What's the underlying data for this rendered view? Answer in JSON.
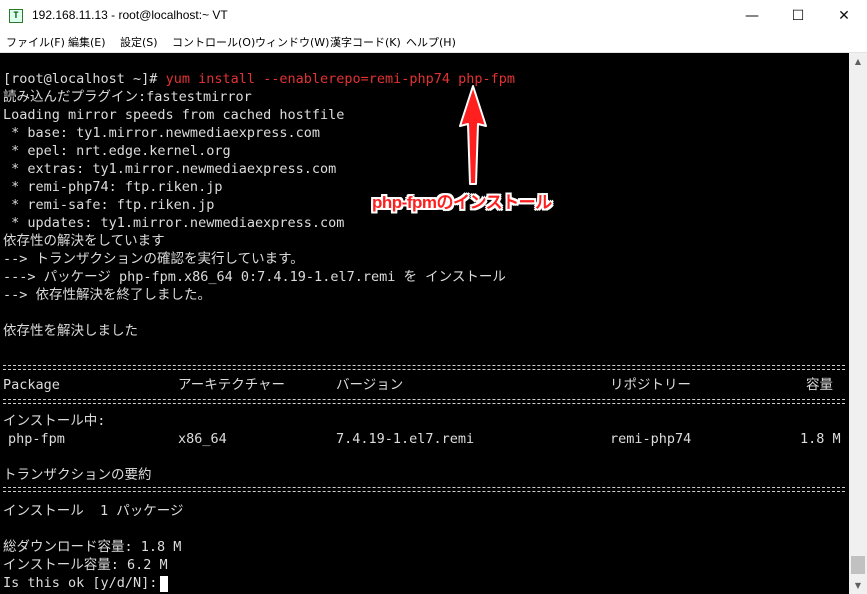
{
  "window": {
    "title": "192.168.11.13 - root@localhost:~ VT",
    "app_icon_glyph": "T",
    "minimize_glyph": "—",
    "maximize_glyph": "☐",
    "close_glyph": "✕"
  },
  "menu": {
    "items": [
      "ファイル(F)",
      "編集(E)",
      "設定(S)",
      "コントロール(O)",
      "ウィンドウ(W)",
      "漢字コード(K)",
      "ヘルプ(H)"
    ]
  },
  "terminal": {
    "prompt": "[root@localhost ~]# ",
    "command": "yum install --enablerepo=remi-php74 php-fpm",
    "lines": [
      "読み込んだプラグイン:fastestmirror",
      "Loading mirror speeds from cached hostfile",
      " * base: ty1.mirror.newmediaexpress.com",
      " * epel: nrt.edge.kernel.org",
      " * extras: ty1.mirror.newmediaexpress.com",
      " * remi-php74: ftp.riken.jp",
      " * remi-safe: ftp.riken.jp",
      " * updates: ty1.mirror.newmediaexpress.com",
      "依存性の解決をしています",
      "--> トランザクションの確認を実行しています。",
      "---> パッケージ php-fpm.x86_64 0:7.4.19-1.el7.remi を インストール",
      "--> 依存性解決を終了しました。",
      "依存性を解決しました"
    ],
    "table_headers": [
      "Package",
      "アーキテクチャー",
      "バージョン",
      "リポジトリー",
      "容量"
    ],
    "install_section_label": "インストール中:",
    "package_row": [
      "php-fpm",
      "x86_64",
      "7.4.19-1.el7.remi",
      "remi-php74",
      "1.8 M"
    ],
    "summary_title": "トランザクションの要約",
    "install_summary": "インストール  1 パッケージ",
    "total_download": "総ダウンロード容量: 1.8 M",
    "installed_size": "インストール容量: 6.2 M",
    "confirm_prompt": "Is this ok [y/d/N]: "
  },
  "annotation": {
    "label": "php-fpmのインストール",
    "color": "#ff1f1f"
  },
  "scrollbar": {
    "up_glyph": "▲",
    "down_glyph": "▼"
  }
}
